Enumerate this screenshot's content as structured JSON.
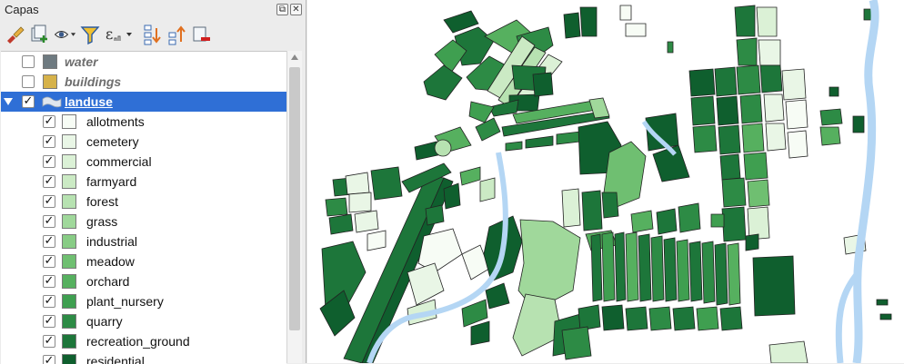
{
  "panel": {
    "title": "Capas",
    "float_icon": "float-panel-icon",
    "close_icon": "close-icon"
  },
  "toolbar": {
    "tools": [
      "style-brush-icon",
      "add-group-icon",
      "visibility-eye-icon",
      "filter-icon",
      "expression-filter-icon",
      "expand-all-icon",
      "collapse-all-icon",
      "remove-layer-icon"
    ]
  },
  "layers": [
    {
      "name": "water",
      "checked": false,
      "color": "#6e7a80"
    },
    {
      "name": "buildings",
      "checked": false,
      "color": "#d6b24a"
    },
    {
      "name": "landuse",
      "checked": true,
      "selected": true
    }
  ],
  "categories": [
    {
      "label": "allotments",
      "color": "#f7fcf5"
    },
    {
      "label": "cemetery",
      "color": "#e9f6e6"
    },
    {
      "label": "commercial",
      "color": "#dbf1d6"
    },
    {
      "label": "farmyard",
      "color": "#cbeac4"
    },
    {
      "label": "forest",
      "color": "#b7e2b1"
    },
    {
      "label": "grass",
      "color": "#a0d89b"
    },
    {
      "label": "industrial",
      "color": "#88cc85"
    },
    {
      "label": "meadow",
      "color": "#6fbf71"
    },
    {
      "label": "orchard",
      "color": "#56b05f"
    },
    {
      "label": "plant_nursery",
      "color": "#3f9f50"
    },
    {
      "label": "quarry",
      "color": "#2d8b45"
    },
    {
      "label": "recreation_ground",
      "color": "#1d763a"
    },
    {
      "label": "residential",
      "color": "#0f5f2e"
    }
  ],
  "map": {
    "water_color": "#b4d6f4",
    "outline_color": "#222222"
  }
}
